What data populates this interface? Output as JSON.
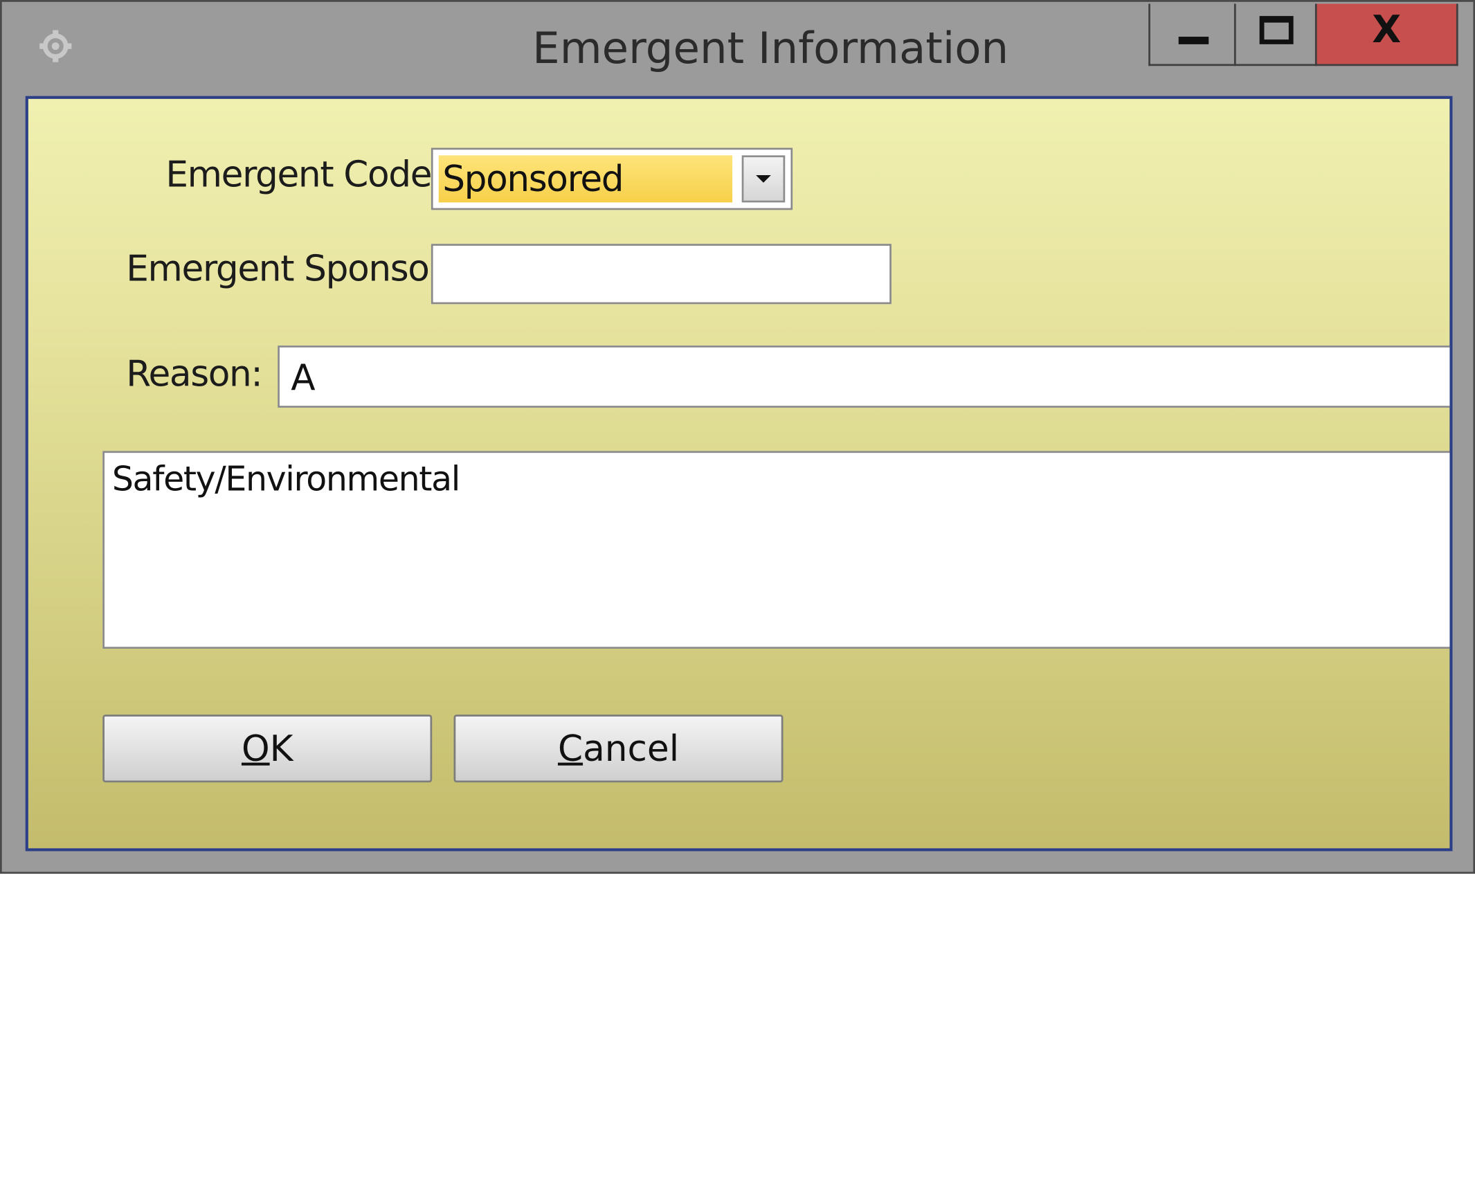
{
  "window": {
    "title": "Emergent Information",
    "app_icon": "gear-icon",
    "controls": {
      "minimize_icon": "minimize-icon",
      "maximize_icon": "maximize-icon",
      "close_icon": "close-icon",
      "close_label": "X"
    }
  },
  "form": {
    "emergent_code": {
      "label": "Emergent Code:",
      "value": "Sponsored",
      "dropdown_icon": "chevron-down-icon"
    },
    "emergent_sponsor": {
      "label": "Emergent Sponsor:",
      "value": ""
    },
    "reason": {
      "label": "Reason:",
      "value": "A"
    },
    "reason_description": {
      "value": "Safety/Environmental"
    }
  },
  "buttons": {
    "ok_label": "OK",
    "cancel_label": "Cancel"
  },
  "colors": {
    "client_top": "#f0f0b0",
    "client_bottom": "#c4bc6c",
    "client_border": "#2b3f88",
    "close_button": "#c7504e",
    "combo_highlight": "#f7d04a"
  }
}
